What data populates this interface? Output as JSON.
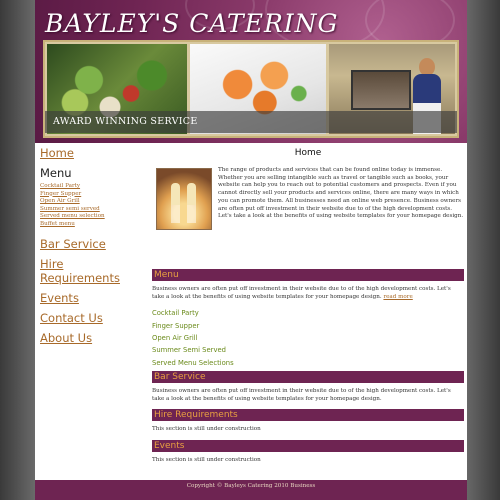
{
  "header": {
    "title": "BAYLEY'S CATERING",
    "award_text": "AWARD WINNING SERVICE"
  },
  "sidebar": {
    "home": "Home",
    "menu_heading": "Menu",
    "menu_links": [
      "Cocktail Party",
      "Finger Supper",
      "Open Air Grill",
      "Summer semi served",
      "Served menu selection",
      "Buffet menu"
    ],
    "bar_service": "Bar Service",
    "hire_requirements": "Hire Requirements",
    "events": "Events",
    "contact_us": "Contact Us",
    "about_us": "About Us"
  },
  "main": {
    "title": "Home",
    "intro": "The range of products and services that can be found online today is immense. Whether you are selling intangible such as travel or tangible such as books, your website can help you to reach out to potential customers and prospects. Even if you cannot directly sell your products and services online, there are many ways in which you can promote them. All businesses need an online web presence. Business owners are often put off investment in their website due to of the high development costs. Let's take a look at the benefits of using website templates for your homepage design.",
    "menu_section": {
      "heading": "Menu",
      "text": "Business owners are often put off investment in their website due to of the high development costs. Let's take a look at the benefits of using website templates for your homepage design.",
      "read_more": "read more",
      "items": [
        "Cocktail Party",
        "Finger Supper",
        "Open Air Grill",
        "Summer Semi Served",
        "Served Menu Selections"
      ]
    },
    "bar_section": {
      "heading": "Bar Service",
      "text": "Business owners are often put off investment in their website due to of the high development costs. Let's take a look at the benefits of using website templates for your homepage design."
    },
    "hire_section": {
      "heading": "Hire Requirements",
      "text": "This section is still under construction"
    },
    "events_section": {
      "heading": "Events",
      "text": "This section is still under construction"
    }
  },
  "footer": {
    "text": "Copyright © Bayleys Catering 2010 Business"
  },
  "colors": {
    "brand_plum": "#6e2452",
    "link_orange": "#a86a2a",
    "section_heading_text": "#e8a040",
    "menu_item_green": "#6a8a1a"
  }
}
